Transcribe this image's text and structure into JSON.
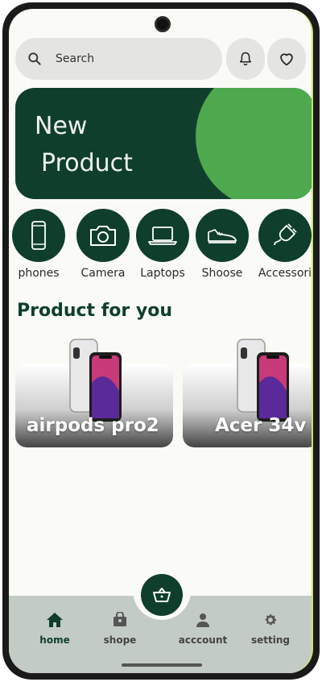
{
  "search": {
    "label": "Search",
    "icon": "search-icon"
  },
  "header_actions": {
    "notification_icon": "bell-icon",
    "favorite_icon": "heart-icon"
  },
  "banner": {
    "line1": "New",
    "line2": "Product",
    "bg_color": "#0f3f2c",
    "accent_color": "#4ea84e"
  },
  "categories": [
    {
      "label": "phones",
      "icon": "phone-icon"
    },
    {
      "label": "Camera",
      "icon": "camera-icon"
    },
    {
      "label": "Laptops",
      "icon": "laptop-icon"
    },
    {
      "label": "Shoose",
      "icon": "shoe-icon"
    },
    {
      "label": "Accessori",
      "icon": "plug-icon"
    }
  ],
  "section": {
    "title": "Product for you"
  },
  "products": [
    {
      "title": "airpods pro2"
    },
    {
      "title": "Acer 34v"
    }
  ],
  "bottom_nav": {
    "items": [
      {
        "label": "home",
        "icon": "home-icon",
        "active": true
      },
      {
        "label": "shope",
        "icon": "shop-bag-icon",
        "active": false
      },
      {
        "label": "acccount",
        "icon": "person-icon",
        "active": false
      },
      {
        "label": "setting",
        "icon": "gear-icon",
        "active": false
      }
    ],
    "fab_icon": "basket-icon"
  }
}
